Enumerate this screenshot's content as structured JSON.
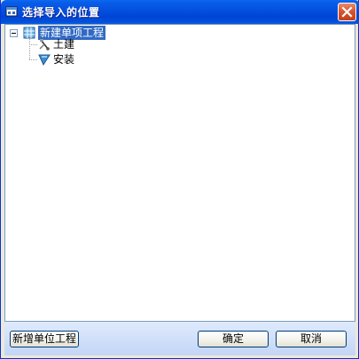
{
  "window": {
    "title": "选择导入的位置"
  },
  "tree": {
    "root": {
      "label": "新建单项工程",
      "expanded": true,
      "toggle": "−"
    },
    "children": [
      {
        "label": "土建",
        "icon": "civil-construction-icon"
      },
      {
        "label": "安装",
        "icon": "installation-icon"
      }
    ]
  },
  "footer": {
    "add_unit_label": "新增单位工程",
    "ok_label": "确定",
    "cancel_label": "取消"
  },
  "colors": {
    "titlebar": "#0451e0",
    "selection": "#316ac5",
    "close": "#d2532e"
  }
}
